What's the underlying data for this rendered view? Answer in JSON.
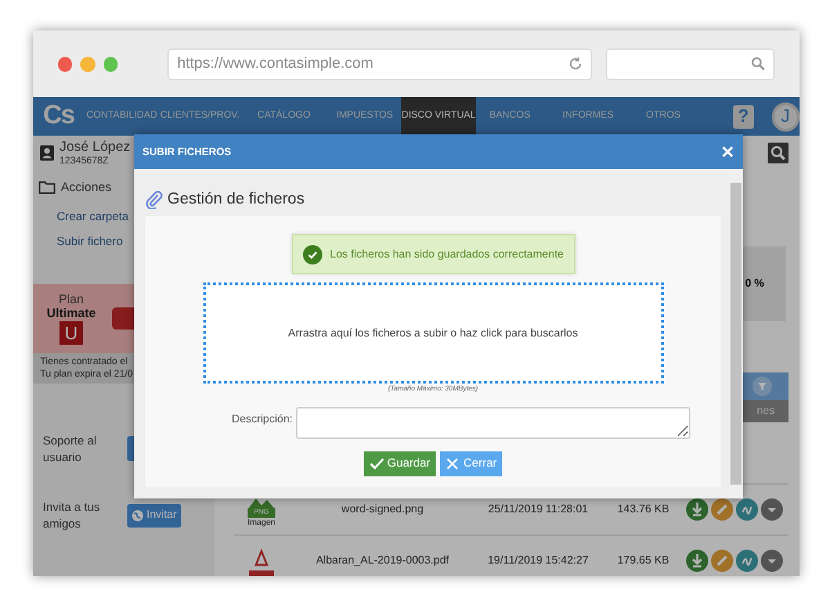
{
  "browser": {
    "url": "https://www.contasimple.com"
  },
  "nav": {
    "logo": "Cs",
    "items": [
      {
        "label": "CONTABILIDAD",
        "selected": false
      },
      {
        "label": "CLIENTES/PROV.",
        "selected": false
      },
      {
        "label": "CATÁLOGO",
        "selected": false
      },
      {
        "label": "IMPUESTOS",
        "selected": false
      },
      {
        "label": "DISCO VIRTUAL",
        "selected": true
      },
      {
        "label": "BANCOS",
        "selected": false
      },
      {
        "label": "INFORMES",
        "selected": false
      },
      {
        "label": "OTROS",
        "selected": false
      }
    ],
    "help": "?",
    "avatar": "J"
  },
  "sidebar": {
    "user_name": "José López",
    "user_id": "12345678Z",
    "section": "Acciones",
    "links": [
      "Crear carpeta",
      "Subir fichero"
    ],
    "plan": {
      "label": "Plan",
      "name": "Ultimate",
      "badge": "U"
    },
    "plan_text": [
      "Tienes contratado el",
      "Tu plan expira el 21/0"
    ],
    "support": "Soporte al usuario",
    "invite": {
      "label": "Invita a tus amigos",
      "button": "Invitar"
    }
  },
  "main": {
    "percent": "0 %",
    "column_header": "nes",
    "files": [
      {
        "kind": "png",
        "badge": "PNG",
        "caption": "Imagen",
        "name": "word-signed.png",
        "date": "25/11/2019 11:28:01",
        "size": "143.76 KB"
      },
      {
        "kind": "pdf",
        "name": "Albaran_AL-2019-0003.pdf",
        "date": "19/11/2019 15:42:27",
        "size": "179.65 KB"
      }
    ]
  },
  "modal": {
    "title": "SUBIR FICHEROS",
    "close": "✕",
    "heading": "Gestión de ficheros",
    "alert": "Los ficheros han sido guardados correctamente",
    "dropzone": "Arrastra aquí los ficheros a subir o haz click para buscarlos",
    "max_size": "(Tamaño Máximo: 30MBytes)",
    "description_label": "Descripción:",
    "buttons": [
      {
        "label": "Guardar",
        "kind": "save"
      },
      {
        "label": "Cerrar",
        "kind": "close"
      }
    ]
  }
}
